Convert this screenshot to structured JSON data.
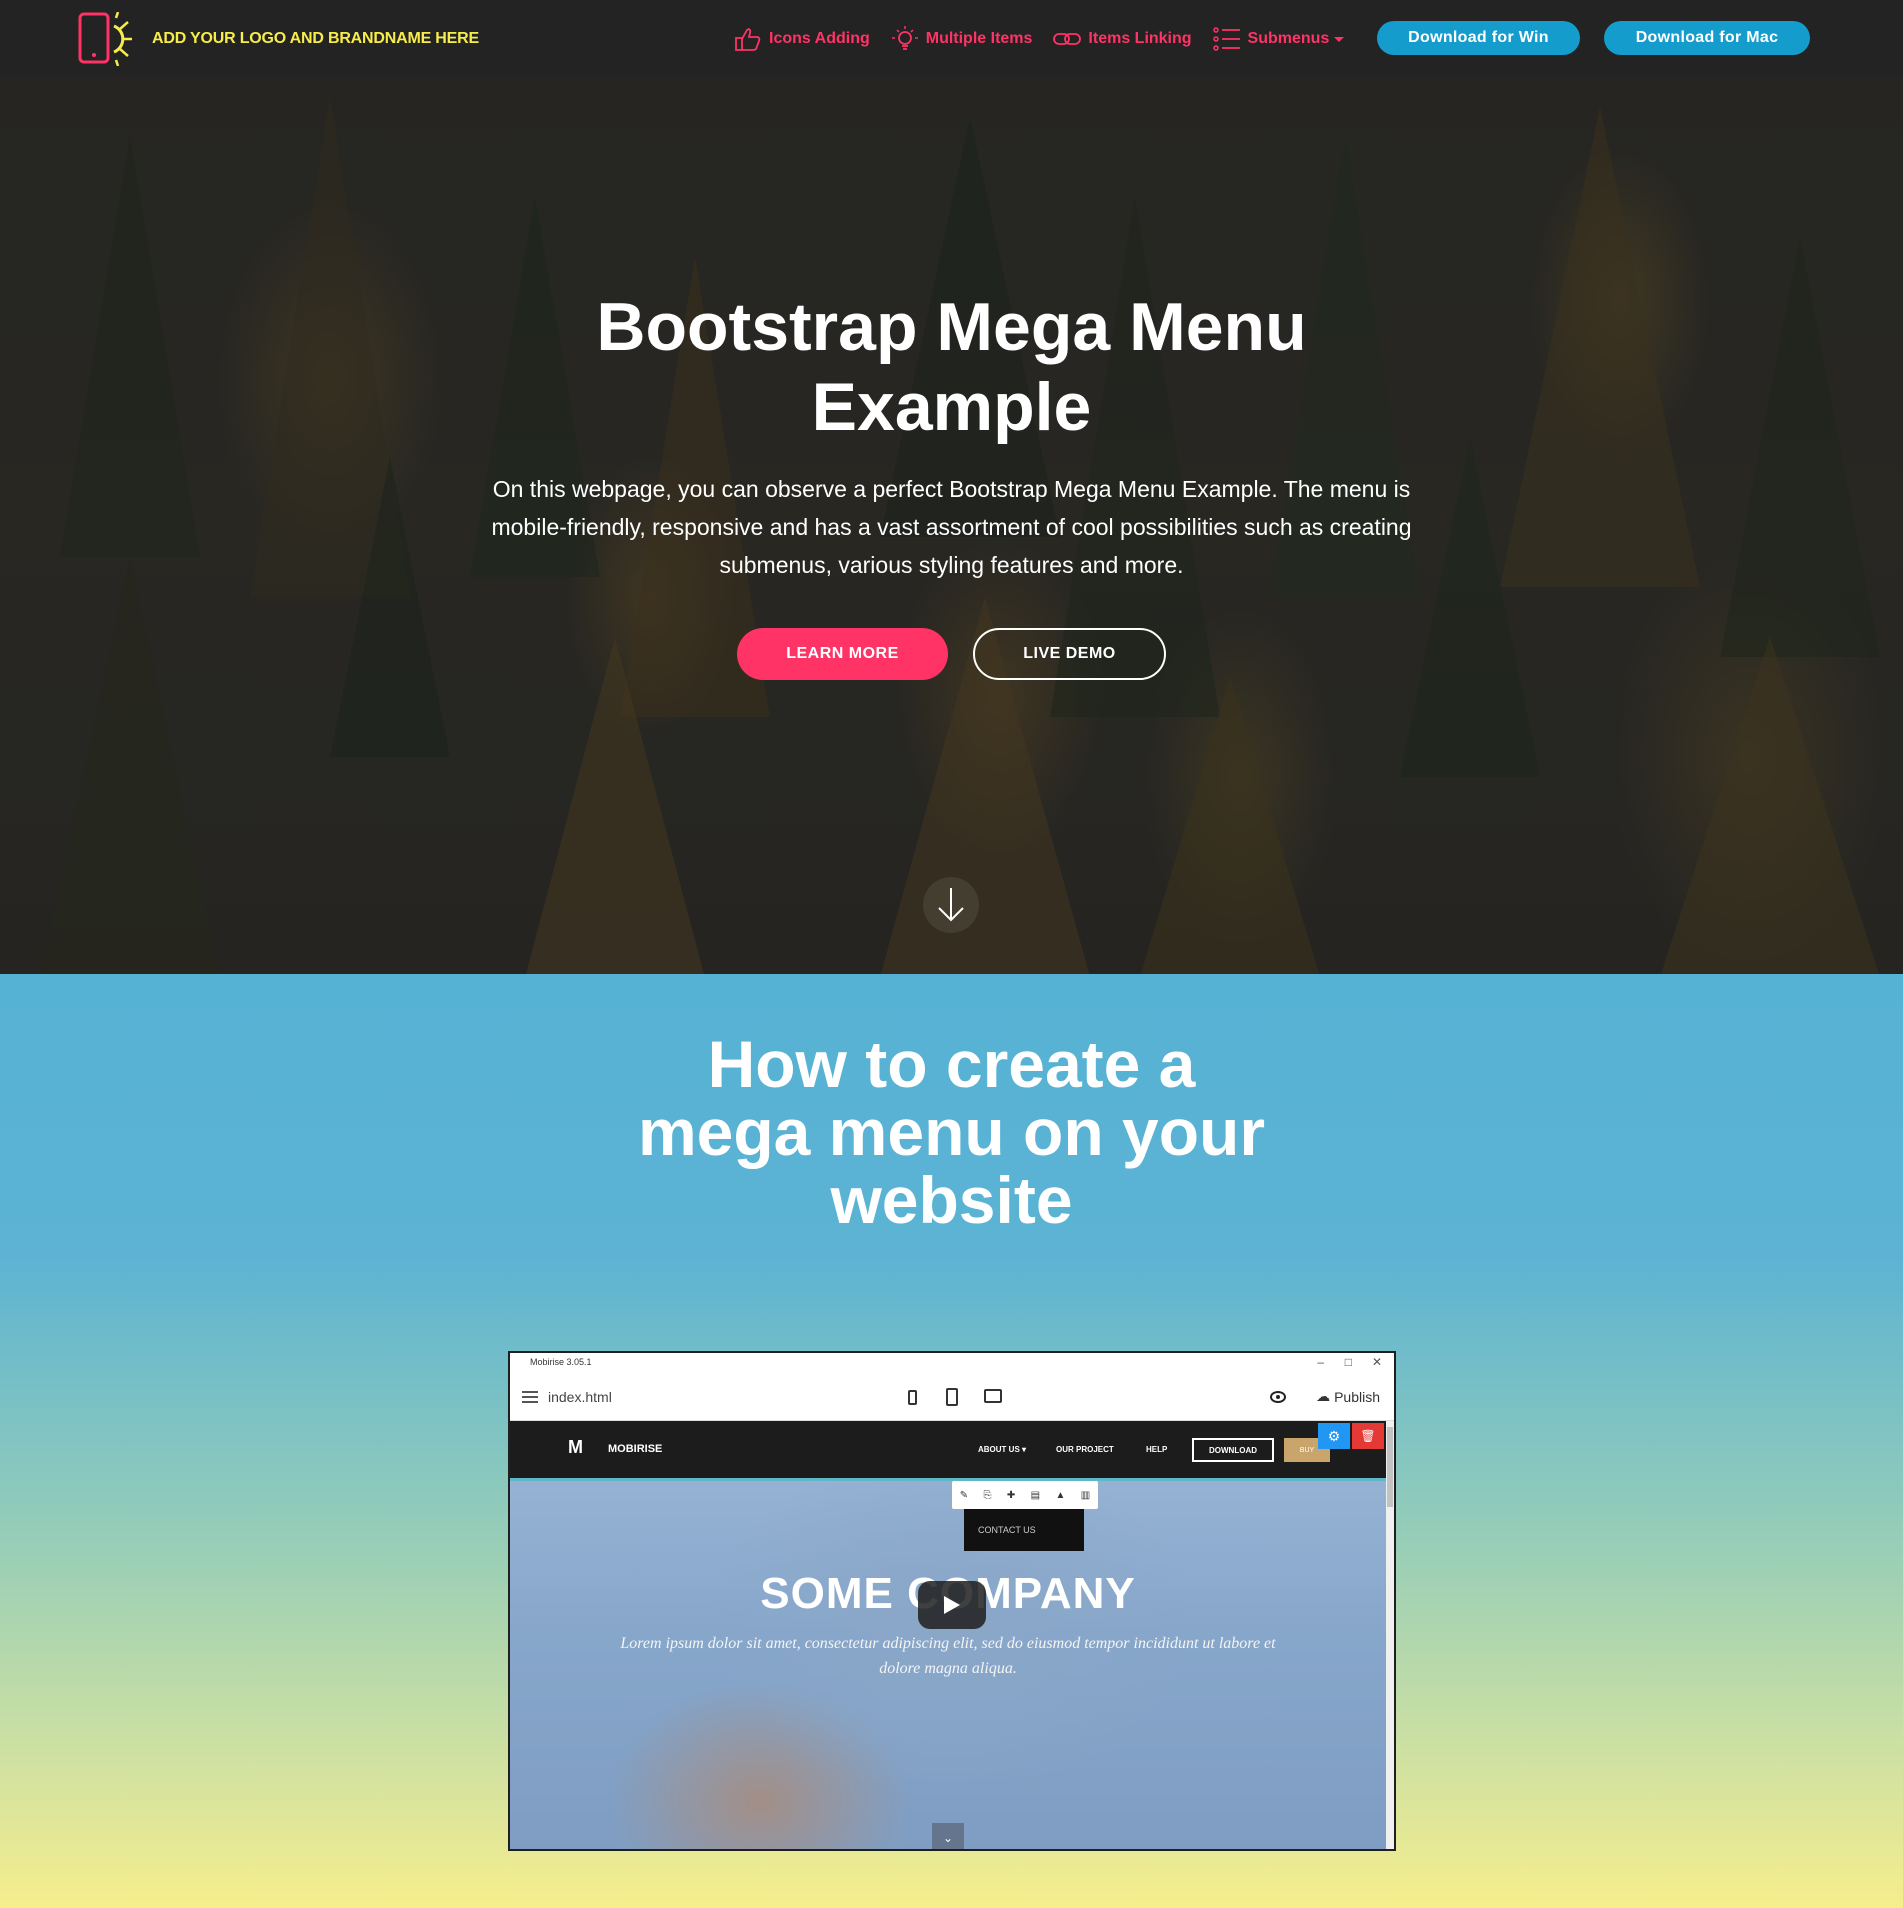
{
  "navbar": {
    "brand_name": "ADD YOUR LOGO AND BRANDNAME HERE",
    "items": [
      {
        "label": "Icons Adding",
        "icon": "thumbs-up-icon"
      },
      {
        "label": "Multiple Items",
        "icon": "lightbulb-icon"
      },
      {
        "label": "Items Linking",
        "icon": "link-icon"
      },
      {
        "label": "Submenus",
        "icon": "list-icon"
      }
    ],
    "download_win": "Download for Win",
    "download_mac": "Download for Mac"
  },
  "hero": {
    "title_line1": "Bootstrap Mega Menu",
    "title_line2": "Example",
    "description": "On this webpage, you can observe a perfect Bootstrap Mega Menu Example. The menu is mobile-friendly, responsive and has a vast assortment of cool possibilities such as creating submenus, various styling features and more.",
    "learn_more": "LEARN MORE",
    "live_demo": "LIVE DEMO"
  },
  "section2": {
    "title_line1": "How to create a",
    "title_line2": "mega menu on your",
    "title_line3": "website"
  },
  "video": {
    "window_title": "Mobirise 3.05.1",
    "file_name": "index.html",
    "publish_label": "Publish",
    "site_brand": "MOBIRISE",
    "site_links": [
      "ABOUT US ▾",
      "OUR PROJECT",
      "HELP"
    ],
    "site_download": "DOWNLOAD",
    "site_buy": "BUY",
    "contact_us": "CONTACT US",
    "site_title": "SOME COMPANY",
    "site_lorem": "Lorem ipsum dolor sit amet, consectetur adipiscing elit, sed do eiusmod tempor incididunt ut labore et dolore magna aliqua."
  },
  "colors": {
    "accent_pink": "#ff3366",
    "brand_yellow": "#f7ed4a",
    "button_blue": "#149dcc",
    "navbar_bg": "#232323"
  }
}
